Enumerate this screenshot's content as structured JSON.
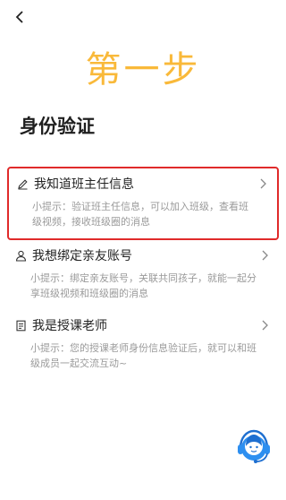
{
  "header": {
    "back_icon": "chevron-left-icon"
  },
  "step_title": "第一步",
  "heading": "身份验证",
  "options": [
    {
      "icon": "pencil-icon",
      "label": "我知道班主任信息",
      "hint": "小提示：验证班主任信息，可以加入班级，查看班级视频，接收班级圈的消息",
      "highlighted": true
    },
    {
      "icon": "person-icon",
      "label": "我想绑定亲友账号",
      "hint": "小提示：绑定亲友账号，关联共同孩子，就能一起分享班级视频和班级圈的消息"
    },
    {
      "icon": "document-icon",
      "label": "我是授课老师",
      "hint": "小提示：您的授课老师身份信息验证后，就可以和班级成员一起交流互动~"
    }
  ],
  "support": {
    "icon": "customer-service-icon"
  },
  "colors": {
    "accent": "#f9b93a",
    "highlight_border": "#e02a2a",
    "support_blue": "#2d8ff0"
  }
}
